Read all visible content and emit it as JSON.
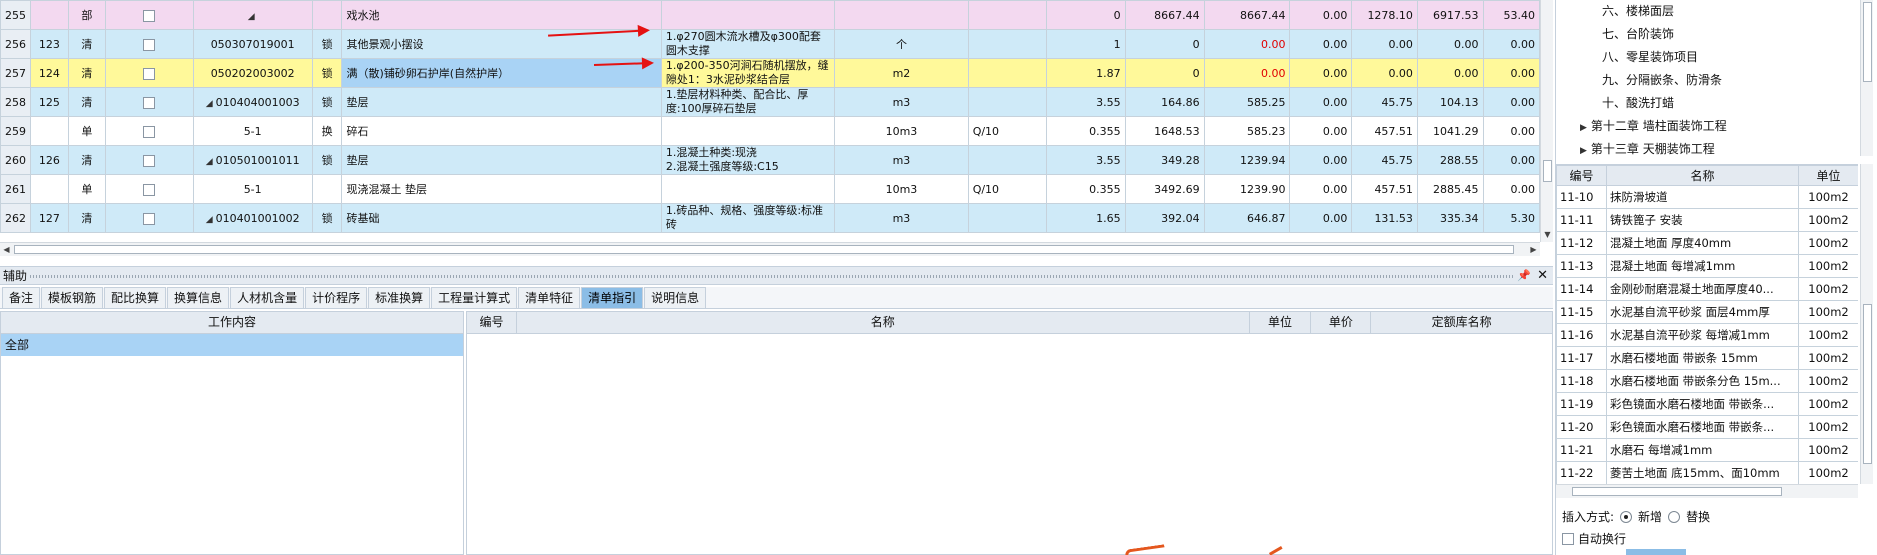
{
  "main_rows": [
    {
      "type": "part",
      "row": "255",
      "no": "",
      "kind": "部",
      "code": "",
      "code_tri": true,
      "lock": "",
      "name": "戏水池",
      "feature": "",
      "unit": "",
      "expr": "",
      "qty": "0",
      "price": "8667.44",
      "total": "8667.44",
      "a": "0.00",
      "b": "1278.10",
      "c": "6917.53",
      "d": "53.40"
    },
    {
      "type": "list",
      "row": "256",
      "no": "123",
      "kind": "清",
      "code": "050307019001",
      "code_tri": false,
      "lock": "锁",
      "name": "其他景观小摆设",
      "feature": "1.φ270圆木流水槽及φ300配套圆木支撑",
      "unit": "个",
      "expr": "",
      "qty": "1",
      "price": "0",
      "total": "0.00",
      "a": "0.00",
      "b": "0.00",
      "c": "0.00",
      "d": "0.00"
    },
    {
      "type": "sel",
      "row": "257",
      "no": "124",
      "kind": "清",
      "code": "050202003002",
      "code_tri": false,
      "lock": "锁",
      "name": "满（散)铺砂卵石护岸(自然护岸）",
      "feature": "1.φ200-350河涧石随机摆放，缝隙处1：3水泥砂浆结合层",
      "unit": "m2",
      "expr": "",
      "qty": "1.87",
      "price": "0",
      "total": "0.00",
      "a": "0.00",
      "b": "0.00",
      "c": "0.00",
      "d": "0.00"
    },
    {
      "type": "list",
      "row": "258",
      "no": "125",
      "kind": "清",
      "code": "010404001003",
      "code_tri": true,
      "lock": "锁",
      "name": "垫层",
      "feature": "1.垫层材料种类、配合比、厚度:100厚碎石垫层",
      "unit": "m3",
      "expr": "",
      "qty": "3.55",
      "price": "164.86",
      "total": "585.25",
      "a": "0.00",
      "b": "45.75",
      "c": "104.13",
      "d": "0.00"
    },
    {
      "type": "quota",
      "row": "259",
      "no": "",
      "kind": "单",
      "code": "5-1",
      "code_tri": false,
      "lock": "换",
      "name": "碎石",
      "feature": "",
      "unit": "10m3",
      "expr": "Q/10",
      "qty": "0.355",
      "price": "1648.53",
      "total": "585.23",
      "a": "0.00",
      "b": "457.51",
      "c": "1041.29",
      "d": "0.00"
    },
    {
      "type": "list",
      "row": "260",
      "no": "126",
      "kind": "清",
      "code": "010501001011",
      "code_tri": true,
      "lock": "锁",
      "name": "垫层",
      "feature": "1.混凝土种类:现浇\n2.混凝土强度等级:C15",
      "unit": "m3",
      "expr": "",
      "qty": "3.55",
      "price": "349.28",
      "total": "1239.94",
      "a": "0.00",
      "b": "45.75",
      "c": "288.55",
      "d": "0.00"
    },
    {
      "type": "quota",
      "row": "261",
      "no": "",
      "kind": "单",
      "code": "5-1",
      "code_tri": false,
      "lock": "",
      "name": "现浇混凝土 垫层",
      "feature": "",
      "unit": "10m3",
      "expr": "Q/10",
      "qty": "0.355",
      "price": "3492.69",
      "total": "1239.90",
      "a": "0.00",
      "b": "457.51",
      "c": "2885.45",
      "d": "0.00"
    },
    {
      "type": "list",
      "row": "262",
      "no": "127",
      "kind": "清",
      "code": "010401001002",
      "code_tri": true,
      "lock": "锁",
      "name": "砖基础",
      "feature": "1.砖品种、规格、强度等级:标准砖",
      "unit": "m3",
      "expr": "",
      "qty": "1.65",
      "price": "392.04",
      "total": "646.87",
      "a": "0.00",
      "b": "131.53",
      "c": "335.34",
      "d": "5.30"
    }
  ],
  "aux": {
    "title": "辅助",
    "pin": "📌",
    "close": "✕",
    "tabs": [
      "备注",
      "模板钢筋",
      "配比换算",
      "换算信息",
      "人材机含量",
      "计价程序",
      "标准换算",
      "工程量计算式",
      "清单特征",
      "清单指引",
      "说明信息"
    ],
    "active_tab": "清单指引"
  },
  "work": {
    "header": "工作内容",
    "rows": [
      "全部"
    ]
  },
  "guide": {
    "headers": [
      "编号",
      "名称",
      "单位",
      "单价",
      "定额库名称"
    ]
  },
  "tree": [
    {
      "level": 2,
      "label": "六、楼梯面层"
    },
    {
      "level": 2,
      "label": "七、台阶装饰"
    },
    {
      "level": 2,
      "label": "八、零星装饰项目"
    },
    {
      "level": 2,
      "label": "九、分隔嵌条、防滑条"
    },
    {
      "level": 2,
      "label": "十、酸洗打蜡"
    },
    {
      "level": 1,
      "label": "第十二章 墙柱面装饰工程"
    },
    {
      "level": 1,
      "label": "第十三章 天棚装饰工程"
    }
  ],
  "lib": {
    "headers": [
      "编号",
      "名称",
      "单位"
    ],
    "rows": [
      [
        "11-10",
        "抹防滑坡道",
        "100m2"
      ],
      [
        "11-11",
        "铸铁篦子 安装",
        "100m2"
      ],
      [
        "11-12",
        "混凝土地面 厚度40mm",
        "100m2"
      ],
      [
        "11-13",
        "混凝土地面 每增减1mm",
        "100m2"
      ],
      [
        "11-14",
        "金刚砂耐磨混凝土地面厚度40...",
        "100m2"
      ],
      [
        "11-15",
        "水泥基自流平砂浆 面层4mm厚",
        "100m2"
      ],
      [
        "11-16",
        "水泥基自流平砂浆 每增减1mm",
        "100m2"
      ],
      [
        "11-17",
        "水磨石楼地面 带嵌条 15mm",
        "100m2"
      ],
      [
        "11-18",
        "水磨石楼地面 带嵌条分色 15m...",
        "100m2"
      ],
      [
        "11-19",
        "彩色镜面水磨石楼地面 带嵌条...",
        "100m2"
      ],
      [
        "11-20",
        "彩色镜面水磨石楼地面 带嵌条...",
        "100m2"
      ],
      [
        "11-21",
        "水磨石 每增减1mm",
        "100m2"
      ],
      [
        "11-22",
        "菱苦土地面 底15mm、面10mm",
        "100m2"
      ]
    ]
  },
  "insert": {
    "label": "插入方式:",
    "opt1": "新增",
    "opt2": "替换",
    "selected": "新增"
  },
  "auto_wrap": "自动换行"
}
